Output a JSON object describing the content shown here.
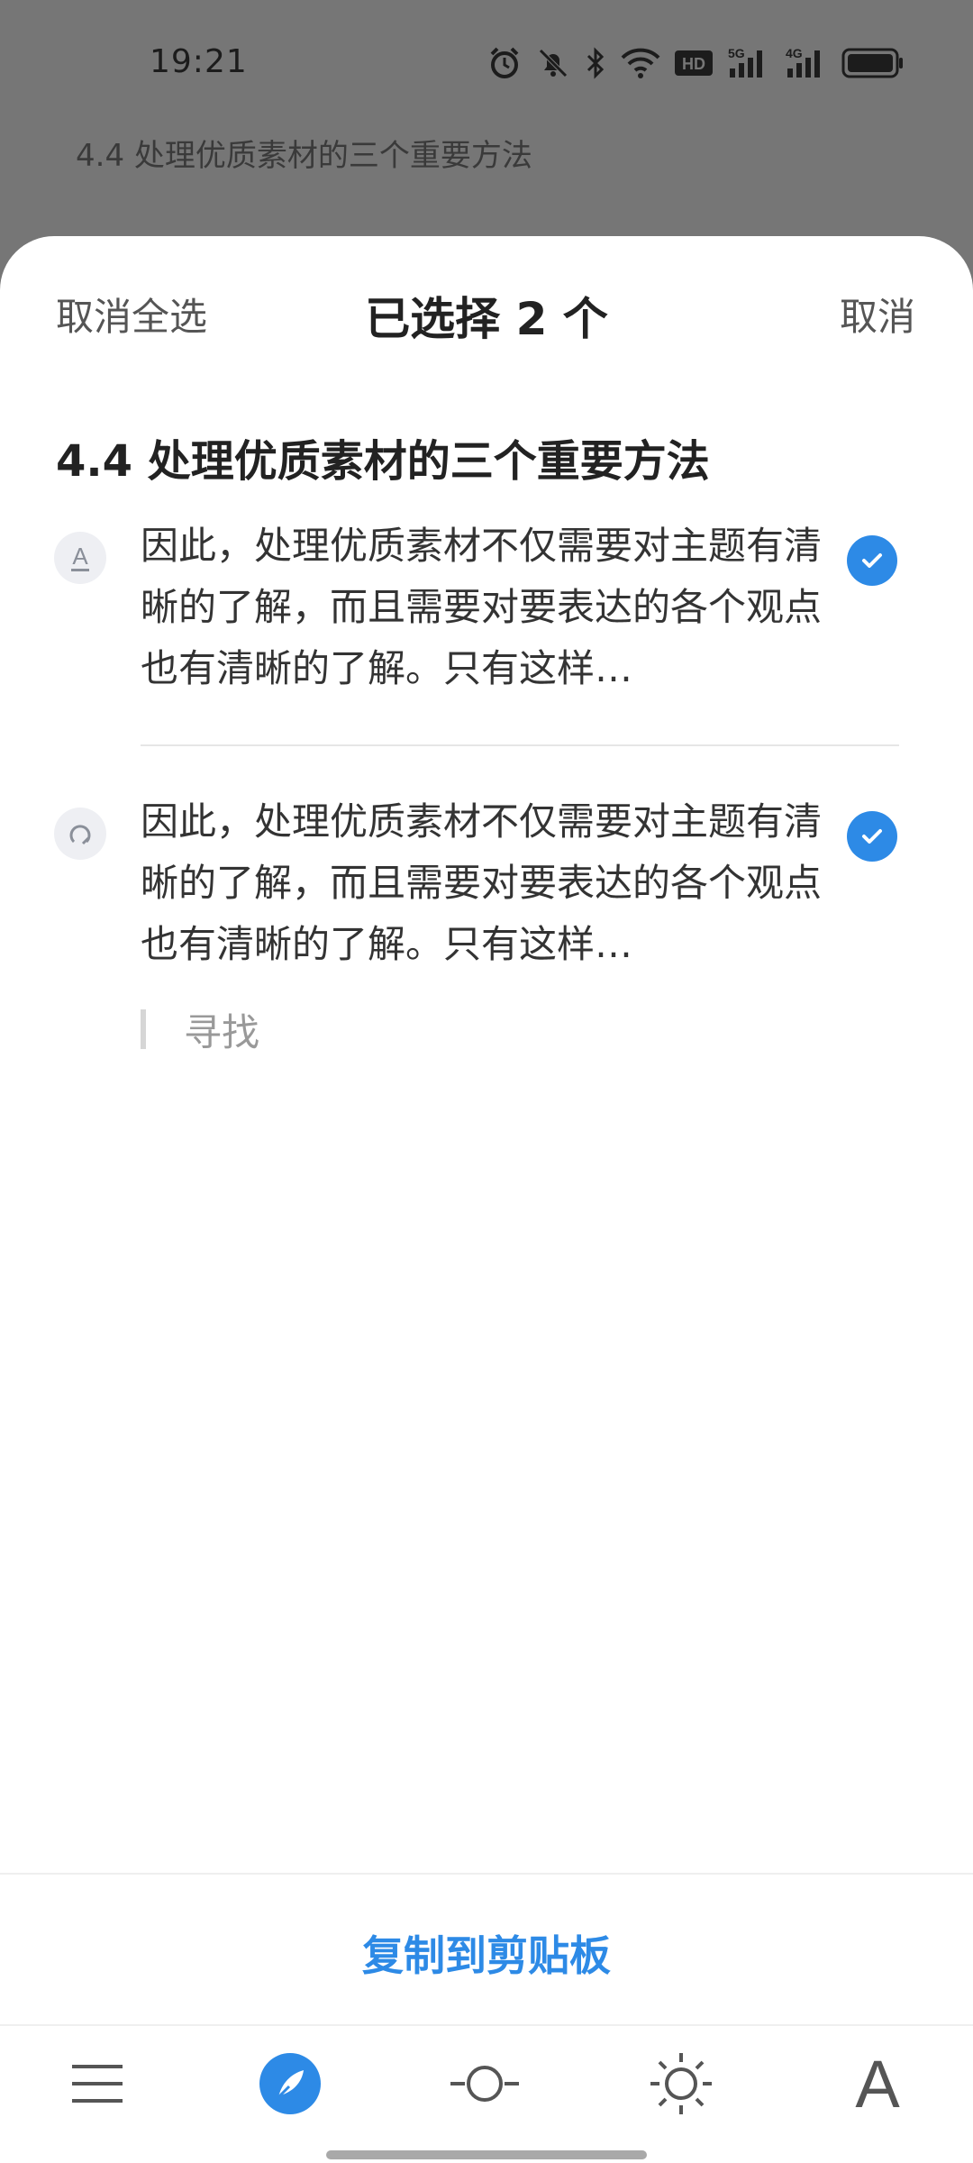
{
  "status_bar": {
    "time": "19:21",
    "icons": [
      "alarm-icon",
      "mute-icon",
      "bluetooth-icon",
      "wifi-icon",
      "hd-icon",
      "signal-5g-icon",
      "signal-4g-icon",
      "battery-icon"
    ],
    "hd_label": "HD",
    "net1": "5G",
    "net2": "4G"
  },
  "background": {
    "page_title": "4.4 处理优质素材的三个重要方法"
  },
  "sheet": {
    "deselect_all": "取消全选",
    "title": "已选择 2 个",
    "cancel": "取消",
    "section_title": "4.4 处理优质素材的三个重要方法",
    "items": [
      {
        "icon": "text-format-icon",
        "icon_glyph": "A",
        "text": "因此，处理优质素材不仅需要对主题有清晰的了解，而且需要对要表达的各个观点也有清晰的了解。只有这样…",
        "checked": true
      },
      {
        "icon": "highlight-note-icon",
        "text": "因此，处理优质素材不仅需要对主题有清晰的了解，而且需要对要表达的各个观点也有清晰的了解。只有这样…",
        "checked": true,
        "note": "寻找"
      }
    ],
    "copy_button": "复制到剪贴板"
  },
  "toolbar": {
    "items": [
      "menu-icon",
      "feather-pen-icon",
      "circle-slider-icon",
      "brightness-icon",
      "font-icon"
    ],
    "font_letter": "A"
  },
  "colors": {
    "accent": "#2d8ae6",
    "overlay": "#767676"
  }
}
